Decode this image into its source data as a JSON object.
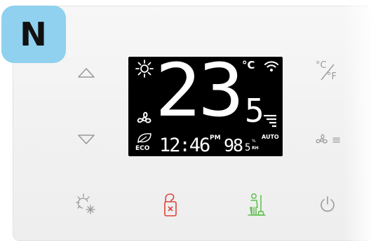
{
  "badge": {
    "letter": "N"
  },
  "display": {
    "temperature_main": "23",
    "temperature_decimal": "5",
    "temp_unit": "°C",
    "time": "12:46",
    "time_period": "PM",
    "humidity_main": "98",
    "humidity_decimal": "5",
    "humidity_unit": "%",
    "humidity_rh": "RH",
    "fan_mode": "AUTO",
    "eco_label": "ECO",
    "fan_speed_level": 4
  },
  "buttons": {
    "unit_toggle": {
      "top": "°C",
      "bottom": "°F"
    },
    "fan_menu_lines": "≡"
  },
  "colors": {
    "badge_bg": "#8fd1ee",
    "panel_bg": "#f3f3f3",
    "icon_gray": "#9a9a9a",
    "dnd_red": "#e0403c",
    "service_green": "#5cbf4b",
    "lcd_bg": "#000000"
  }
}
